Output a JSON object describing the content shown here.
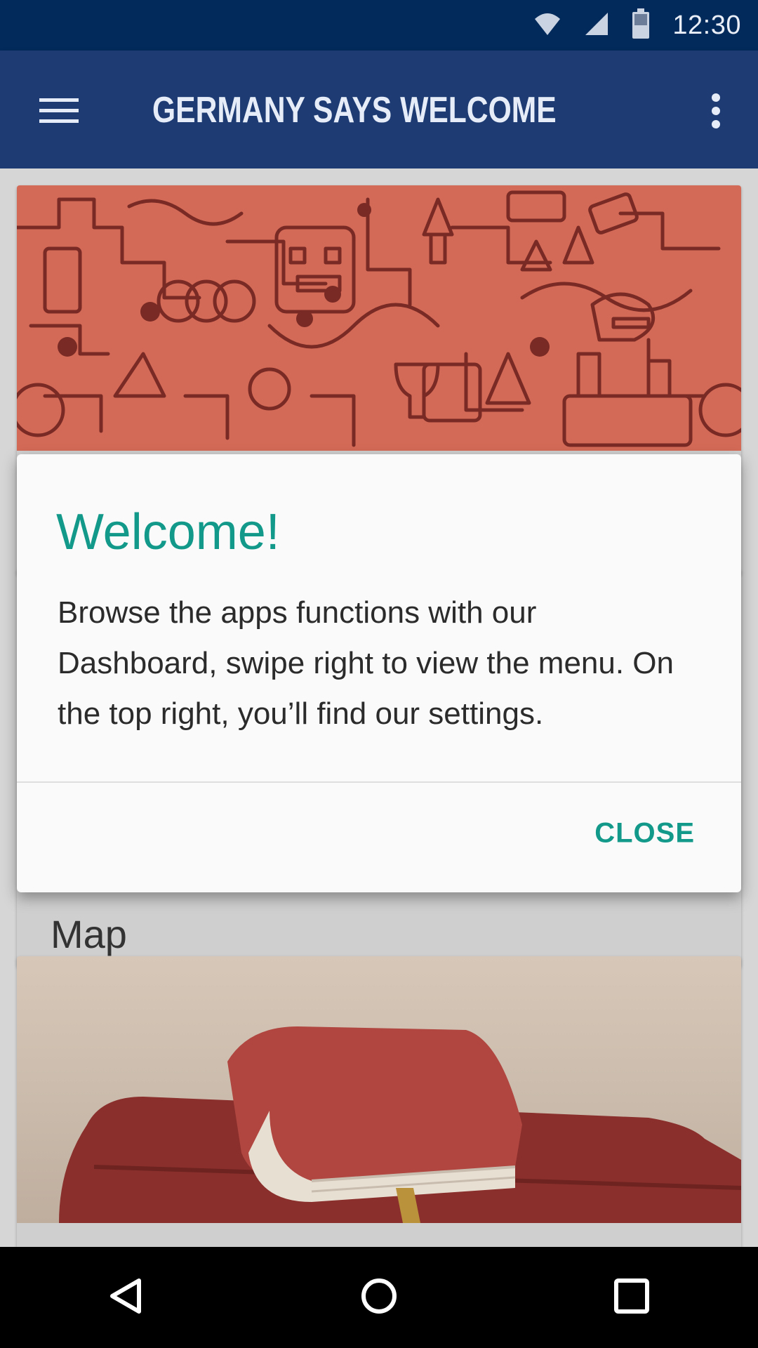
{
  "status_bar": {
    "time": "12:30",
    "icons": [
      "wifi-icon",
      "cell-signal-icon",
      "battery-icon"
    ]
  },
  "app_bar": {
    "title": "GERMANY SAYS WELCOME",
    "menu_icon": "hamburger-menu-icon",
    "overflow_icon": "more-vertical-icon"
  },
  "cards": {
    "card_2": {
      "label": "Map"
    }
  },
  "dialog": {
    "title": "Welcome!",
    "body": "Browse the apps functions with our Dashboard, swipe right to view the menu. On the top right, you’ll find our settings.",
    "close_label": "CLOSE"
  },
  "nav_bar": {
    "back_icon": "back-icon",
    "home_icon": "home-icon",
    "recents_icon": "recents-icon"
  },
  "colors": {
    "status_bar": "#022a5b",
    "app_bar": "#1e3b73",
    "accent": "#13998a",
    "pattern_bg": "#d36a57",
    "pattern_line": "#7a2a24"
  }
}
